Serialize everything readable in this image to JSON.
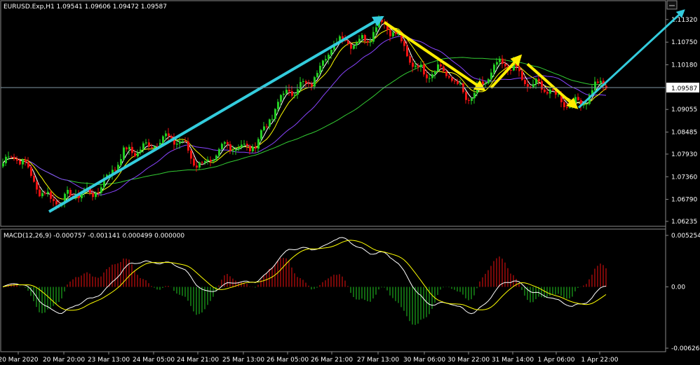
{
  "main": {
    "symbol_label": "EURUSD.Exp,H1  1.09541 1.09606 1.09472 1.09587",
    "current_price_label": "1.09587",
    "price_ticks": [
      "1.11320",
      "1.10750",
      "1.10180",
      "1.09587",
      "1.09055",
      "1.08485",
      "1.07930",
      "1.07360",
      "1.06790",
      "1.06235"
    ]
  },
  "macd": {
    "label": "MACD(12,26,9) -0.000757 -0.001141 0.000499 0.000000",
    "ticks": [
      "0.005254",
      "0.00",
      "-0.006262"
    ]
  },
  "x_ticks": [
    "20 Mar 2020",
    "20 Mar 20:00",
    "23 Mar 13:00",
    "24 Mar 05:00",
    "24 Mar 21:00",
    "25 Mar 13:00",
    "26 Mar 05:00",
    "26 Mar 21:00",
    "27 Mar 13:00",
    "30 Mar 06:00",
    "30 Mar 22:00",
    "31 Mar 14:00",
    "1 Apr 06:00",
    "1 Apr 22:00"
  ],
  "colors": {
    "background": "#000000",
    "bull_candle": "#22cc22",
    "bear_candle": "#ee1111",
    "ma_fast": "#ffffff",
    "ma_mid": "#ffff00",
    "ma_slow": "#8844ff",
    "ma_long": "#33cc33",
    "trend_arrow": "#33ccdd",
    "swing_arrow": "#ffee00"
  },
  "chart_data": [
    {
      "type": "candlestick",
      "title": "EURUSD.Exp,H1",
      "open": 1.09541,
      "high": 1.09606,
      "low": 1.09472,
      "close": 1.09587,
      "ylim": [
        1.06235,
        1.116
      ],
      "price_path": [
        [
          "20 Mar 2020",
          1.077
        ],
        [
          "20 Mar 20:00",
          1.066
        ],
        [
          "23 Mar 13:00",
          1.0742
        ],
        [
          "24 Mar 05:00",
          1.0842
        ],
        [
          "24 Mar 21:00",
          1.0782
        ],
        [
          "25 Mar 13:00",
          1.0805
        ],
        [
          "26 Mar 05:00",
          1.0935
        ],
        [
          "26 Mar 21:00",
          1.105
        ],
        [
          "27 Mar 13:00",
          1.112
        ],
        [
          "30 Mar 06:00",
          1.101
        ],
        [
          "30 Mar 22:00",
          1.095
        ],
        [
          "31 Mar 14:00",
          1.102
        ],
        [
          "1 Apr 06:00",
          1.092
        ],
        [
          "1 Apr 22:00",
          1.0955
        ]
      ]
    },
    {
      "type": "histogram",
      "title": "MACD(12,26,9)",
      "values": [
        -0.000757,
        -0.001141,
        0.000499,
        0.0
      ],
      "ylim": [
        -0.006262,
        0.005254
      ]
    }
  ]
}
